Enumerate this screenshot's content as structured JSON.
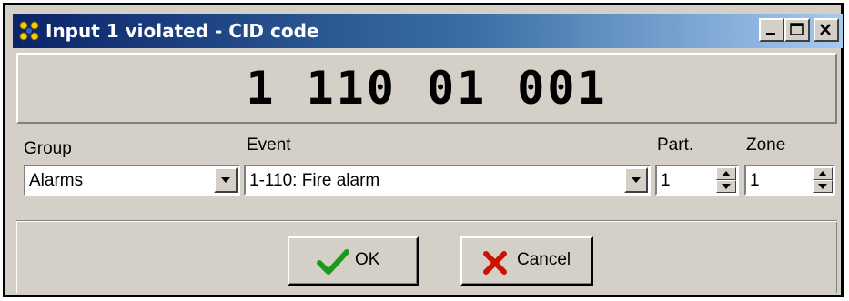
{
  "window": {
    "title": "Input 1 violated - CID code",
    "icon": "app-icon",
    "controls": {
      "minimize_icon": "minimize-icon",
      "maximize_icon": "maximize-icon",
      "close_icon": "close-icon"
    }
  },
  "code": "1 110 01 001",
  "fields": {
    "group": {
      "label": "Group",
      "value": "Alarms"
    },
    "event": {
      "label": "Event",
      "value": "1-110: Fire alarm"
    },
    "partition": {
      "label": "Part.",
      "value": "1"
    },
    "zone": {
      "label": "Zone",
      "value": "1"
    }
  },
  "buttons": {
    "ok": {
      "label": "OK",
      "icon": "checkmark-icon",
      "icon_color": "#1a9a1a"
    },
    "cancel": {
      "label": "Cancel",
      "icon": "x-icon",
      "icon_color": "#cc1100"
    }
  },
  "colors": {
    "title_gradient_start": "#0a246a",
    "title_gradient_end": "#a6caf0",
    "face": "#d4d0c8"
  }
}
